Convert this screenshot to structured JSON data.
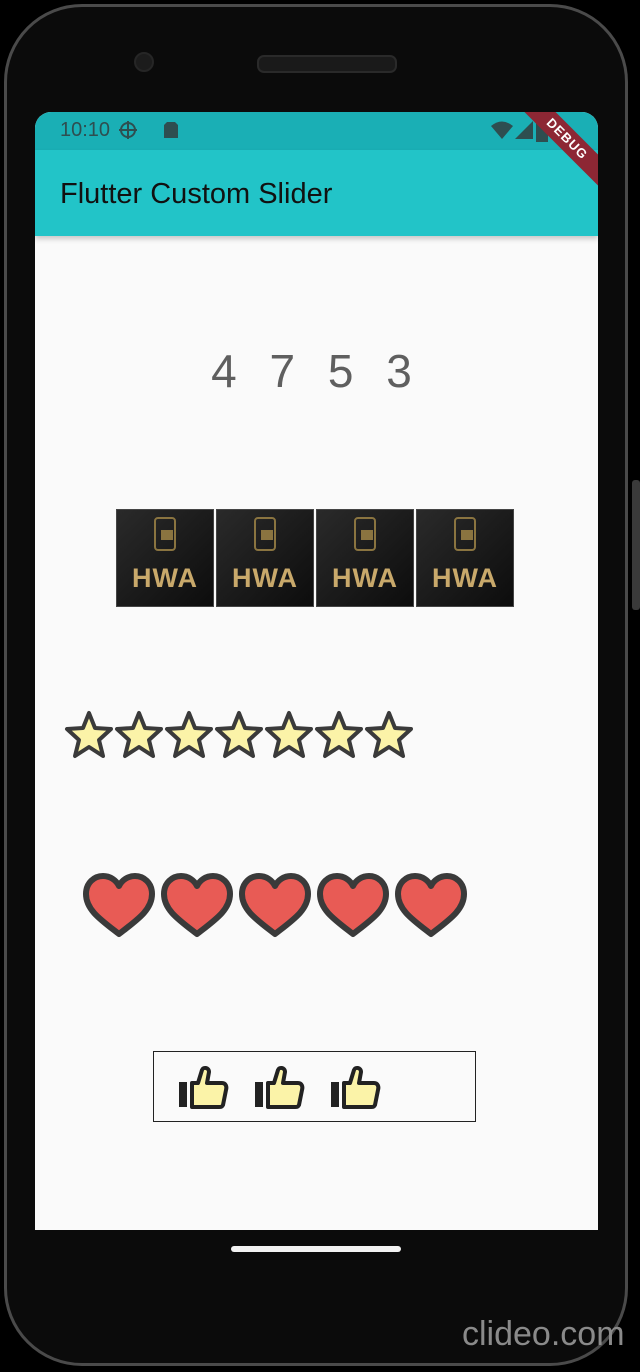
{
  "status_bar": {
    "time": "10:10",
    "icons": [
      "crosshair-icon",
      "sim-card-icon",
      "wifi-icon",
      "signal-icon",
      "battery-icon"
    ]
  },
  "app_bar": {
    "title": "Flutter Custom Slider",
    "debug_banner": "DEBUG",
    "color": "#22c4c8"
  },
  "counter": {
    "values": "4 7 5 3"
  },
  "image_slider": {
    "count": 4,
    "tile_text": "HWA"
  },
  "star_slider": {
    "count": 7,
    "icon": "star-icon",
    "fill": "#fbf3a8",
    "stroke": "#3a3a3a"
  },
  "heart_slider": {
    "count": 5,
    "icon": "heart-icon",
    "fill": "#e85b55",
    "stroke": "#3a3a3a"
  },
  "thumb_slider": {
    "count": 3,
    "icon": "thumbs-up-icon",
    "fill": "#fbf3a8",
    "stroke": "#222222"
  },
  "watermark": "clideo.com"
}
